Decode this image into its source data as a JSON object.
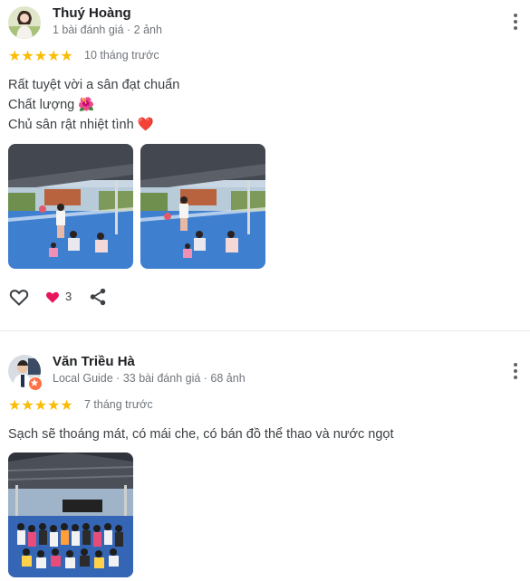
{
  "reviews": [
    {
      "name": "Thuý Hoàng",
      "meta": "1 bài đánh giá · 2 ảnh",
      "rating": 5,
      "time": "10 tháng trước",
      "lines": [
        "Rất tuyệt vời a sân đạt chuẩn",
        "Chất lượng 🌺",
        "Chủ sân rật nhiệt tình ❤️"
      ],
      "like_count": "3"
    },
    {
      "name": "Văn Triều Hà",
      "meta": "Local Guide · 33 bài đánh giá · 68 ảnh",
      "rating": 5,
      "time": "7 tháng trước",
      "lines": [
        "Sạch sẽ thoáng mát, có mái che, có bán đồ thể thao và nước ngọt"
      ]
    }
  ],
  "icons": {
    "star": "star-icon",
    "menu": "more-vert-icon",
    "like": "heart-outline-icon",
    "reaction": "heart-filled-icon",
    "share": "share-icon",
    "badge": "local-guide-badge-icon"
  },
  "colors": {
    "star": "#fbbc04",
    "court_blue": "#3f7fcf",
    "roof": "#3a3f48",
    "reaction": "#e8175d",
    "badge": "#ff7043"
  }
}
